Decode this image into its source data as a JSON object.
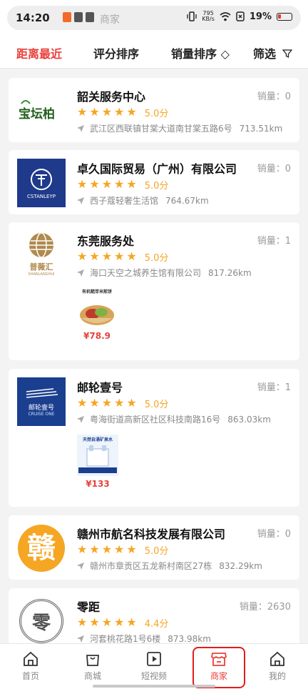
{
  "status": {
    "time": "14:20",
    "ghost_text": "商家",
    "net_speed_value": "795",
    "net_speed_unit": "KB/s",
    "battery": "19%"
  },
  "filters": [
    {
      "label": "距离最近",
      "active": true
    },
    {
      "label": "评分排序"
    },
    {
      "label": "销量排序 ◇"
    },
    {
      "label": "筛选"
    }
  ],
  "stores": [
    {
      "name": "韶关服务中心",
      "sales": "销量：0",
      "rating": "5.0分",
      "stars": 5,
      "address": "武江区西联镇甘棠大道南甘棠五路6号",
      "distance": "713.51km",
      "logo_text": "宝坛柏"
    },
    {
      "name": "卓久国际贸易（广州）有限公司",
      "sales": "销量：0",
      "rating": "5.0分",
      "stars": 5,
      "address": "西子蔻轻奢生活馆",
      "distance": "764.67km",
      "logo_text": "CSTANLEYP"
    },
    {
      "name": "东莞服务处",
      "sales": "销量：1",
      "rating": "5.0分",
      "stars": 5,
      "address": "海口天空之城养生馆有限公司",
      "distance": "817.26km",
      "logo_text": "普薇汇",
      "logo_sub": "SHANLANGHUI",
      "product_price": "¥78.9",
      "product_caption": "有机糙芽米煎饼"
    },
    {
      "name": "邮轮壹号",
      "sales": "销量：1",
      "rating": "5.0分",
      "stars": 5,
      "address": "粤海街道高新区社区科技南路16号",
      "distance": "863.03km",
      "logo_text": "邮轮壹号",
      "logo_sub": "CRUISE ONE",
      "product_price": "¥133",
      "product_caption": "天然自涌矿泉水"
    },
    {
      "name": "赣州市航名科技发展有限公司",
      "sales": "销量：0",
      "rating": "5.0分",
      "stars": 5,
      "address": "赣州市章贡区五龙新村南区27栋",
      "distance": "832.29km",
      "logo_text": "赣"
    },
    {
      "name": "零距",
      "sales": "销量：2630",
      "rating": "4.4分",
      "stars": 5,
      "address": "河套桃花路1号6楼",
      "distance": "873.98km",
      "logo_text": "零"
    }
  ],
  "bottom_nav": [
    {
      "label": "首页"
    },
    {
      "label": "商城"
    },
    {
      "label": "短视频"
    },
    {
      "label": "商家",
      "active": true
    },
    {
      "label": "我的"
    }
  ],
  "colors": {
    "accent": "#e8413a",
    "star": "#f5a623"
  }
}
